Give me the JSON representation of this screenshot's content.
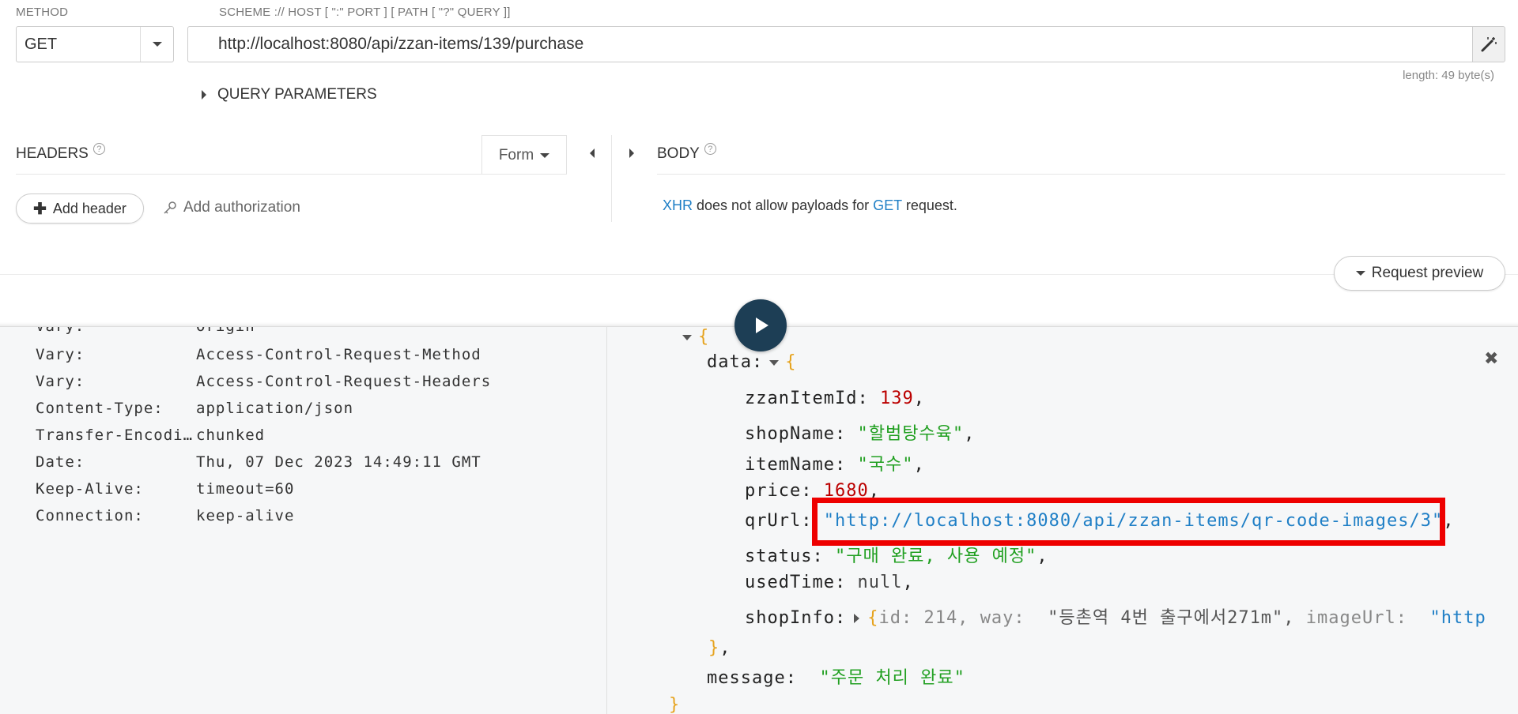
{
  "request": {
    "method_label": "METHOD",
    "method_value": "GET",
    "url_label": "SCHEME :// HOST [ \":\" PORT ] [ PATH [ \"?\" QUERY ]]",
    "url_value": "http://localhost:8080/api/zzan-items/139/purchase",
    "length_text": "length: 49 byte(s)",
    "query_params_label": "QUERY PARAMETERS"
  },
  "headers_panel": {
    "title": "HEADERS",
    "help": "?",
    "form_label": "Form",
    "add_header_label": "Add header",
    "add_auth_label": "Add authorization"
  },
  "body_panel": {
    "title": "BODY",
    "help": "?",
    "note_xhr": "XHR",
    "note_mid": " does not allow payloads for ",
    "note_get": "GET",
    "note_end": " request."
  },
  "request_preview_label": "Request preview",
  "response_headers": [
    {
      "key": "Vary:",
      "value": "Origin"
    },
    {
      "key": "Vary:",
      "value": "Access-Control-Request-Method"
    },
    {
      "key": "Vary:",
      "value": "Access-Control-Request-Headers"
    },
    {
      "key": "Content-Type:",
      "value": "application/json"
    },
    {
      "key": "Transfer-Encodin…",
      "value": "chunked"
    },
    {
      "key": "Date:",
      "value": "Thu, 07 Dec 2023 14:49:11 GMT"
    },
    {
      "key": "Keep-Alive:",
      "value": "timeout=60"
    },
    {
      "key": "Connection:",
      "value": "keep-alive"
    }
  ],
  "response_json": {
    "open_brace": "{",
    "data_key": "data:",
    "data_open": "{",
    "zzanItemId_key": "zzanItemId:",
    "zzanItemId_val": "139",
    "shopName_key": "shopName:",
    "shopName_val": "\"할범탕수육\"",
    "itemName_key": "itemName:",
    "itemName_val": "\"국수\"",
    "price_key": "price:",
    "price_val": "1680",
    "qrUrl_key": "qrUrl:",
    "qrUrl_val": "\"http://localhost:8080/api/zzan-items/qr-code-images/3\"",
    "status_key": "status:",
    "status_val": "\"구매 완료, 사용 예정\"",
    "usedTime_key": "usedTime:",
    "usedTime_val": "null",
    "shopInfo_key": "shopInfo:",
    "shopInfo_preview_open": "{",
    "shopInfo_preview_id": "id:  214,",
    "shopInfo_preview_way_key": "way:",
    "shopInfo_preview_way_val": "\"등촌역 4번 출구에서271m\",",
    "shopInfo_preview_img_key": "imageUrl:",
    "shopInfo_preview_img_val": "\"http",
    "data_close": "}",
    "message_key": "message:",
    "message_val": "\"주문 처리 완료\"",
    "close_brace": "}"
  },
  "comma": ",",
  "colors": {
    "accent_link": "#1f7fc6",
    "play_button": "#1d3e55",
    "highlight": "#ee0000",
    "json_string": "#22a022",
    "json_number": "#b00000",
    "json_brace": "#e6a31e"
  }
}
